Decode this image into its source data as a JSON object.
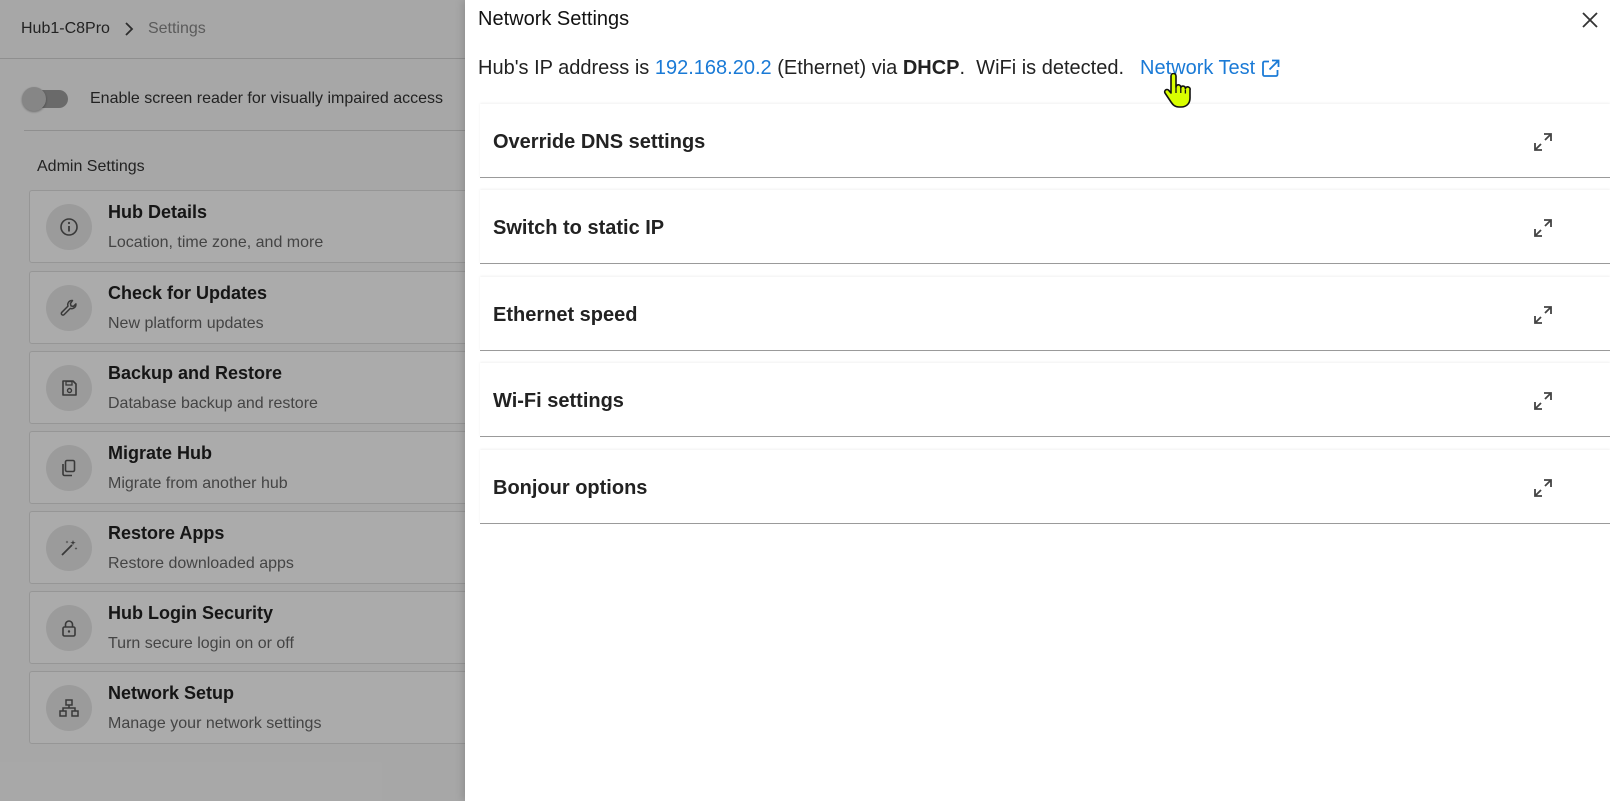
{
  "breadcrumb": {
    "hub": "Hub1-C8Pro",
    "current": "Settings"
  },
  "accessibility": {
    "label": "Enable screen reader for visually impaired access",
    "enabled": false
  },
  "admin": {
    "heading": "Admin Settings",
    "items": [
      {
        "title": "Hub Details",
        "subtitle": "Location, time zone, and more",
        "icon": "info-icon"
      },
      {
        "title": "Check for Updates",
        "subtitle": "New platform updates",
        "icon": "wrench-icon"
      },
      {
        "title": "Backup and Restore",
        "subtitle": "Database backup and restore",
        "icon": "save-icon"
      },
      {
        "title": "Migrate Hub",
        "subtitle": "Migrate from another hub",
        "icon": "copy-icon"
      },
      {
        "title": "Restore Apps",
        "subtitle": "Restore downloaded apps",
        "icon": "magic-wand-icon"
      },
      {
        "title": "Hub Login Security",
        "subtitle": "Turn secure login on or off",
        "icon": "lock-icon"
      },
      {
        "title": "Network Setup",
        "subtitle": "Manage your network settings",
        "icon": "network-icon"
      }
    ]
  },
  "dialog": {
    "title": "Network Settings",
    "ip_prefix": "Hub's IP address is",
    "ip_address": "192.168.20.2",
    "ip_mid": "(Ethernet) via",
    "ip_mode": "DHCP",
    "ip_suffix": ".  WiFi is detected.",
    "network_test": "Network Test",
    "sections": [
      {
        "label": "Override DNS settings"
      },
      {
        "label": "Switch to static IP"
      },
      {
        "label": "Ethernet speed"
      },
      {
        "label": "Wi-Fi settings"
      },
      {
        "label": "Bonjour options"
      }
    ]
  },
  "colors": {
    "link": "#1a7ad6",
    "overlay": "rgba(0,0,0,0.33)",
    "cursor": "#d9ff00"
  }
}
